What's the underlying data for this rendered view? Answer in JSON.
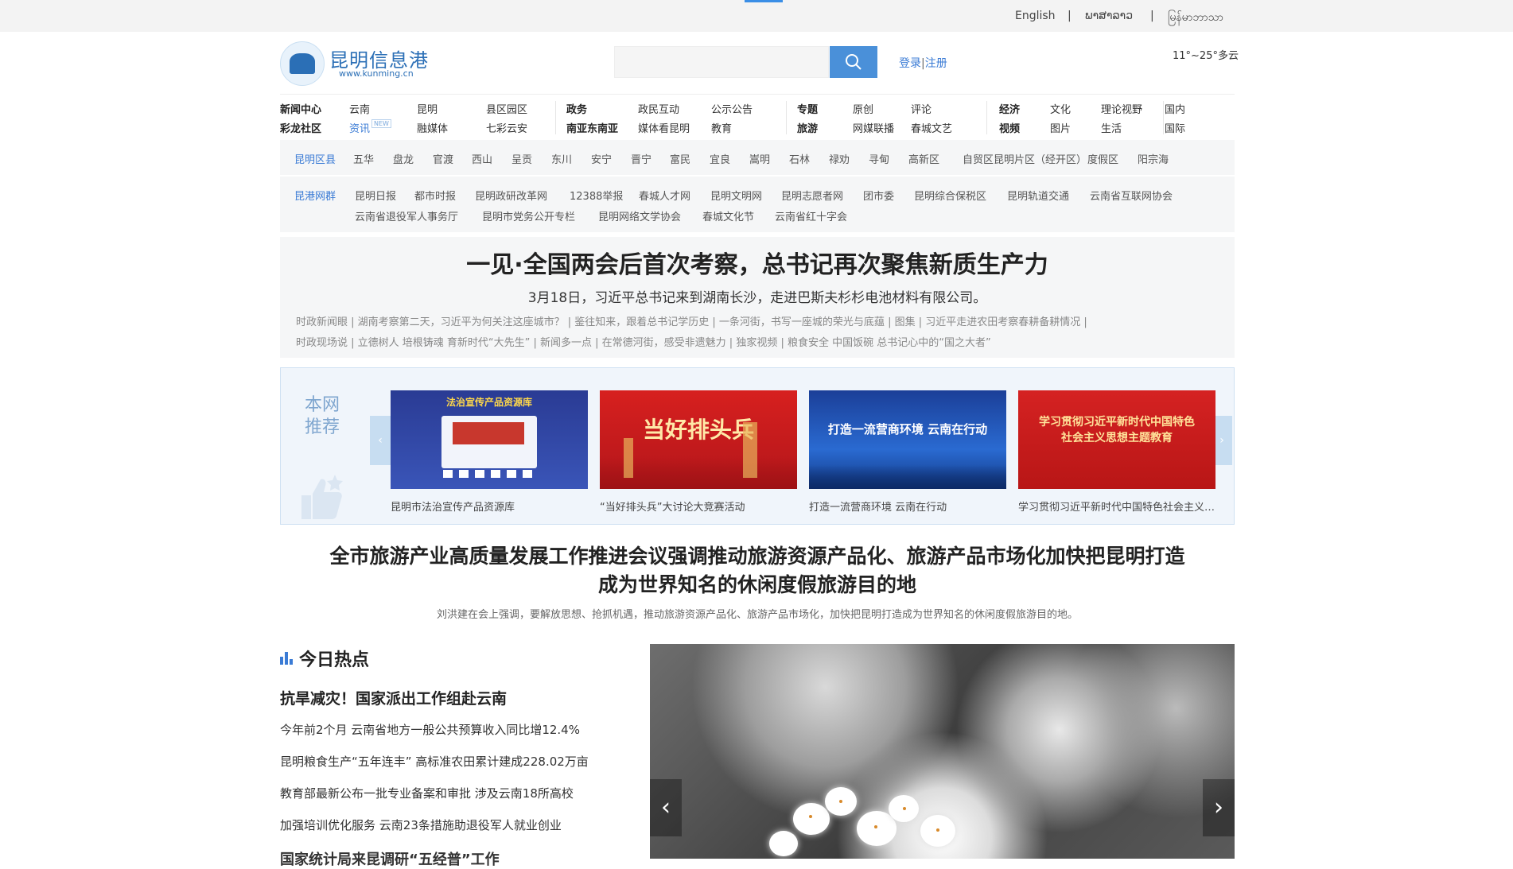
{
  "topbar": {
    "languages": [
      "English",
      "ພາສາລາວ",
      "မြန်မာဘာသာ"
    ],
    "separator": "|"
  },
  "header": {
    "site_name": "昆明信息港",
    "site_url": "www.kunming.cn",
    "search_placeholder": "",
    "login": "登录",
    "register": "注册",
    "login_sep": "|",
    "weather": "11°~25°多云"
  },
  "nav": {
    "col1": [
      [
        "新闻中心",
        "云南",
        "昆明",
        "县区园区"
      ],
      [
        "彩龙社区",
        "资讯",
        "融媒体",
        "七彩云安"
      ]
    ],
    "new_badge": "NEW",
    "col2": [
      [
        "政务",
        "政民互动",
        "公示公告"
      ],
      [
        "南亚东南亚",
        "媒体看昆明",
        "教育"
      ]
    ],
    "col3": [
      [
        "专题",
        "原创",
        "评论"
      ],
      [
        "旅游",
        "网媒联播",
        "春城文艺"
      ]
    ],
    "col4": [
      [
        "经济",
        "文化",
        "理论视野",
        "国内"
      ],
      [
        "视频",
        "图片",
        "生活",
        "国际"
      ]
    ]
  },
  "district": {
    "label": "昆明区县",
    "items": [
      "五华",
      "盘龙",
      "官渡",
      "西山",
      "呈贡",
      "东川",
      "安宁",
      "晋宁",
      "富民",
      "宜良",
      "嵩明",
      "石林",
      "禄劝",
      "寻甸",
      "高新区",
      "自贸区昆明片区（经开区）",
      "度假区",
      "阳宗海"
    ]
  },
  "group": {
    "label": "昆港网群",
    "row1": [
      "昆明日报",
      "都市时报",
      "昆明政研改革网",
      "12388举报",
      "春城人才网",
      "昆明文明网",
      "昆明志愿者网",
      "团市委",
      "昆明综合保税区",
      "昆明轨道交通",
      "云南省互联网协会"
    ],
    "row2": [
      "云南省退役军人事务厅",
      "昆明市党务公开专栏",
      "昆明网络文学协会",
      "春城文化节",
      "云南省红十字会"
    ]
  },
  "headline1": {
    "title": "一见·全国两会后首次考察，总书记再次聚焦新质生产力",
    "subtitle": "3月18日，习近平总书记来到湖南长沙，走进巴斯夫杉杉电池材料有限公司。",
    "links_line1": "时政新闻眼 | 湖南考察第二天，习近平为何关注这座城市？  |  鉴往知来，跟着总书记学历史 | 一条河街，书写一座城的荣光与底蕴  |  图集 | 习近平走进农田考察春耕备耕情况  |",
    "links_line2": "时政现场说 | 立德树人 培根铸魂 育新时代“大先生”  |  新闻多一点 | 在常德河街，感受非遗魅力  |  独家视频 | 粮食安全 中国饭碗 总书记心中的“国之大者”"
  },
  "recommend": {
    "badge_line1": "本网",
    "badge_line2": "推荐",
    "prev": "‹",
    "next": "›",
    "items": [
      {
        "caption": "昆明市法治宣传产品资源库",
        "banner": "法治宣传产品资源库",
        "color": "#2d3f9a"
      },
      {
        "caption": "“当好排头兵”大讨论大竞赛活动",
        "banner": "当好排头兵",
        "color": "#c81c1c"
      },
      {
        "caption": "打造一流营商环境 云南在行动",
        "banner": "打造一流营商环境  云南在行动",
        "color": "#1d4fa8"
      },
      {
        "caption": "学习贯彻习近平新时代中国特色社会主义思想主题教育",
        "banner": "学习贯彻习近平新时代中国特色社会主义思想主题教育",
        "color": "#cc1a1a"
      }
    ]
  },
  "headline2": {
    "title_line1": "全市旅游产业高质量发展工作推进会议强调推动旅游资源产品化、旅游产品市场化加快把昆明打造",
    "title_line2": "成为世界知名的休闲度假旅游目的地",
    "subtitle": "刘洪建在会上强调，要解放思想、抢抓机遇，推动旅游资源产品化、旅游产品市场化，加快把昆明打造成为世界知名的休闲度假旅游目的地。"
  },
  "hot": {
    "title": "今日热点",
    "first": "抗旱减灾！国家派出工作组赴云南",
    "items": [
      "今年前2个月 云南省地方一般公共预算收入同比增12.4%",
      "昆明粮食生产“五年连丰” 高标准农田累计建成228.02万亩",
      "教育部最新公布一批专业备案和审批 涉及云南18所高校",
      "加强培训优化服务 云南23条措施助退役军人就业创业",
      "国家统计局来昆调研“五经普”工作"
    ]
  },
  "photo": {
    "prev": "‹",
    "next": "›"
  },
  "colors": {
    "accent": "#3a7bd5",
    "brand": "#2b6fb6",
    "panel": "#f5f6f7"
  }
}
